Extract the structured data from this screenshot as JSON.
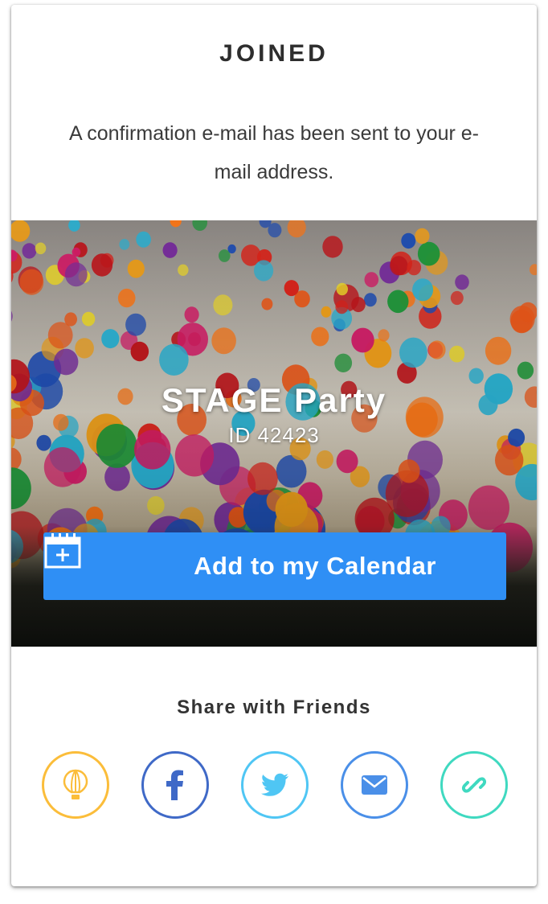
{
  "header": {
    "title": "JOINED",
    "message": "A confirmation e-mail has been sent to your e-mail address."
  },
  "event": {
    "name": "STAGE Party",
    "id_text": "ID 42423",
    "add_calendar_label": "Add to my Calendar"
  },
  "share": {
    "title": "Share with Friends",
    "buttons": [
      {
        "name": "balloon",
        "icon": "balloon-icon",
        "color": "#fbbd3a"
      },
      {
        "name": "facebook",
        "icon": "facebook-icon",
        "color": "#3f69c7"
      },
      {
        "name": "twitter",
        "icon": "twitter-icon",
        "color": "#4fc6f4"
      },
      {
        "name": "email",
        "icon": "mail-icon",
        "color": "#4a8fe8"
      },
      {
        "name": "link",
        "icon": "link-icon",
        "color": "#3fd9c0"
      }
    ]
  },
  "colors": {
    "accent": "#2f8ff5",
    "title_text": "#2d2d2d"
  }
}
